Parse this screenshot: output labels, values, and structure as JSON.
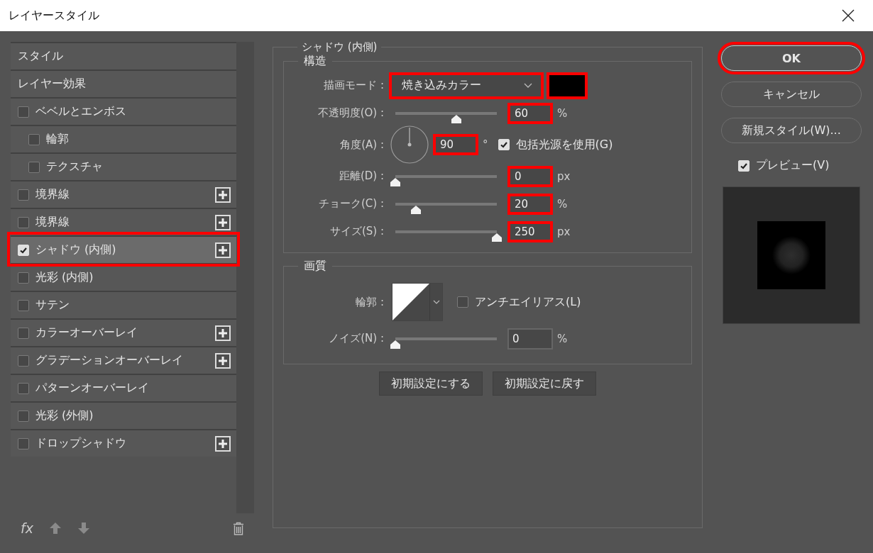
{
  "window": {
    "title": "レイヤースタイル"
  },
  "styles_panel": {
    "items": [
      {
        "kind": "header",
        "label": "スタイル",
        "selected": false,
        "highlighted": false
      },
      {
        "kind": "header",
        "label": "レイヤー効果",
        "selected": false,
        "highlighted": false
      },
      {
        "kind": "effect",
        "label": "ベベルとエンボス",
        "checked": false,
        "selected": false,
        "highlighted": false,
        "plus": false,
        "children": [
          {
            "kind": "effect",
            "label": "輪郭",
            "checked": false,
            "selected": false,
            "highlighted": false,
            "plus": false
          },
          {
            "kind": "effect",
            "label": "テクスチャ",
            "checked": false,
            "selected": false,
            "highlighted": false,
            "plus": false
          }
        ]
      },
      {
        "kind": "effect",
        "label": "境界線",
        "checked": false,
        "selected": false,
        "highlighted": false,
        "plus": true
      },
      {
        "kind": "effect",
        "label": "境界線",
        "checked": false,
        "selected": false,
        "highlighted": false,
        "plus": true
      },
      {
        "kind": "effect",
        "label": "シャドウ (内側)",
        "checked": true,
        "selected": true,
        "highlighted": true,
        "plus": true
      },
      {
        "kind": "effect",
        "label": "光彩 (内側)",
        "checked": false,
        "selected": false,
        "highlighted": false,
        "plus": false
      },
      {
        "kind": "effect",
        "label": "サテン",
        "checked": false,
        "selected": false,
        "highlighted": false,
        "plus": false
      },
      {
        "kind": "effect",
        "label": "カラーオーバーレイ",
        "checked": false,
        "selected": false,
        "highlighted": false,
        "plus": true
      },
      {
        "kind": "effect",
        "label": "グラデーションオーバーレイ",
        "checked": false,
        "selected": false,
        "highlighted": false,
        "plus": true
      },
      {
        "kind": "effect",
        "label": "パターンオーバーレイ",
        "checked": false,
        "selected": false,
        "highlighted": false,
        "plus": false
      },
      {
        "kind": "effect",
        "label": "光彩 (外側)",
        "checked": false,
        "selected": false,
        "highlighted": false,
        "plus": false
      },
      {
        "kind": "effect",
        "label": "ドロップシャドウ",
        "checked": false,
        "selected": false,
        "highlighted": false,
        "plus": true
      }
    ],
    "toolbar": {
      "fx": "fx"
    }
  },
  "effect_panel": {
    "title": "シャドウ (内側)",
    "structure": {
      "title": "構造",
      "rows": [
        {
          "kind": "select",
          "label": "描画モード :",
          "value": "焼き込みカラー",
          "highlighted": true,
          "swatch_highlighted": true
        },
        {
          "kind": "slider",
          "label": "不透明度(O) :",
          "level": 0.6,
          "value": "60",
          "unit": "%",
          "highlighted": true
        },
        {
          "kind": "angle",
          "label": "角度(A) :",
          "value": "90",
          "unit": "°",
          "highlighted": true,
          "option": {
            "label": "包括光源を使用(G)",
            "checked": true
          }
        },
        {
          "kind": "slider",
          "label": "距離(D) :",
          "level": 0,
          "value": "0",
          "unit": "px",
          "highlighted": true
        },
        {
          "kind": "slider",
          "label": "チョーク(C) :",
          "level": 0.2,
          "value": "20",
          "unit": "%",
          "highlighted": true
        },
        {
          "kind": "slider",
          "label": "サイズ(S) :",
          "level": 1,
          "value": "250",
          "unit": "px",
          "highlighted": true
        }
      ]
    },
    "quality": {
      "title": "画質",
      "rows": [
        {
          "kind": "contour",
          "label": "輪郭 :",
          "option": {
            "label": "アンチエイリアス(L)",
            "checked": false
          }
        },
        {
          "kind": "slider",
          "label": "ノイズ(N) :",
          "level": 0,
          "value": "0",
          "unit": "%",
          "highlighted": false
        }
      ]
    },
    "buttons": [
      "初期設定にする",
      "初期設定に戻す"
    ]
  },
  "actions": {
    "buttons": [
      {
        "label": "OK",
        "default": true,
        "highlighted": true
      },
      {
        "label": "キャンセル",
        "default": false,
        "highlighted": false
      },
      {
        "label": "新規スタイル(W)...",
        "default": false,
        "highlighted": false
      }
    ],
    "preview": {
      "label": "プレビュー(V)",
      "checked": true
    }
  }
}
